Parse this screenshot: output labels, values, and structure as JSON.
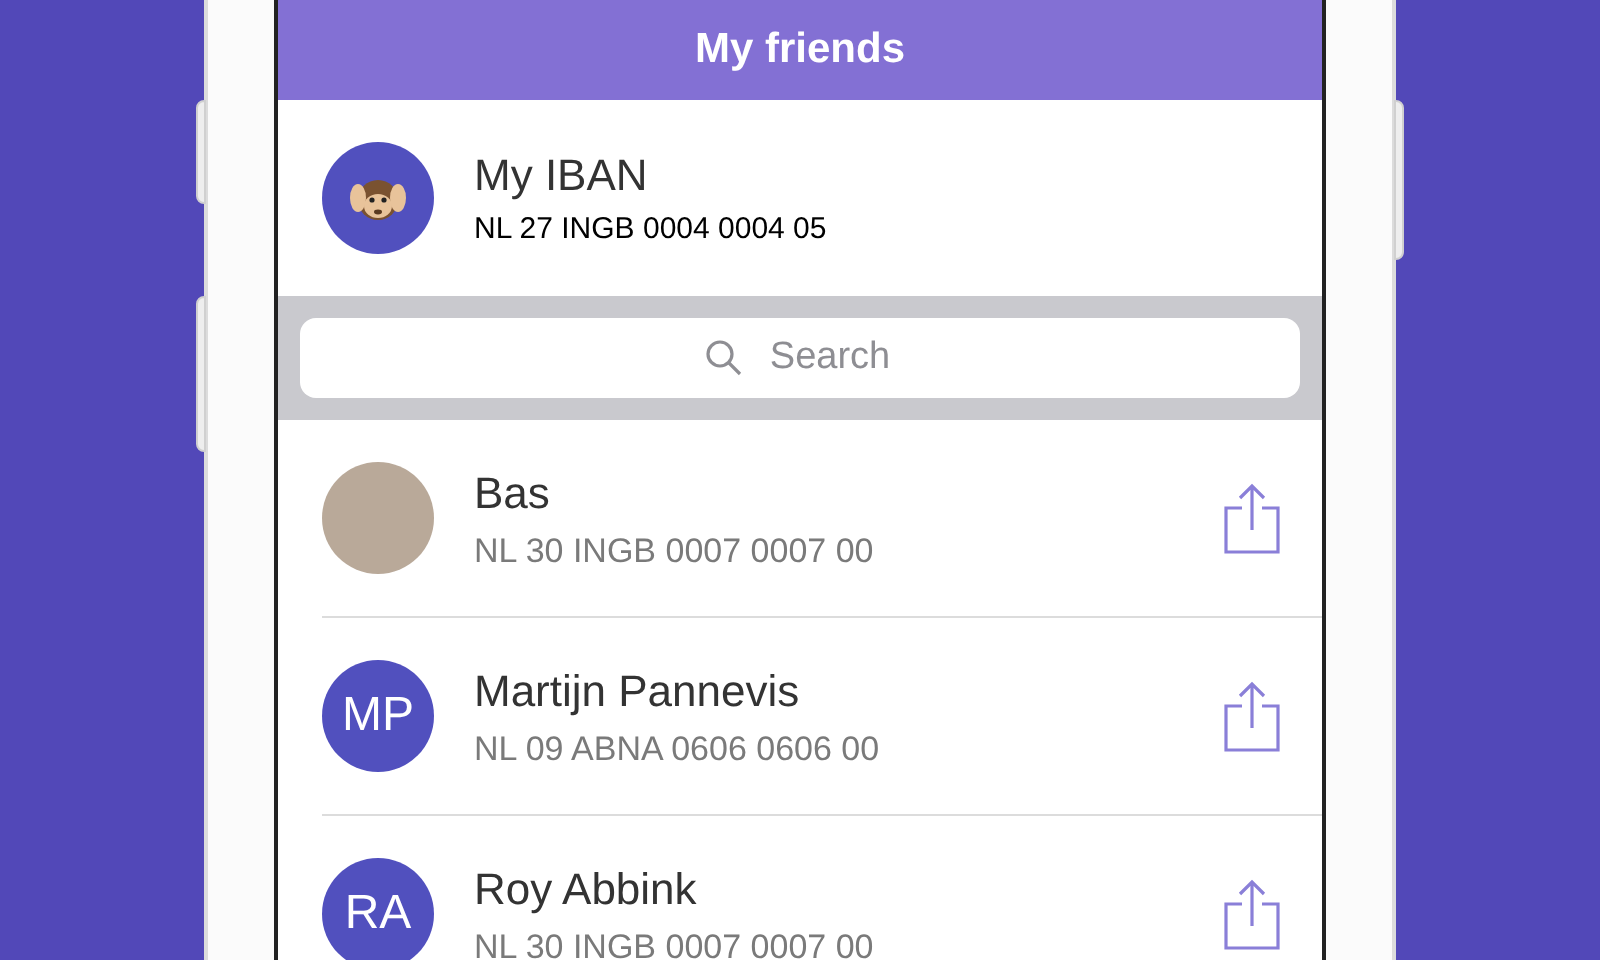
{
  "header": {
    "title": "My friends"
  },
  "my_iban": {
    "label": "My IBAN",
    "iban": "NL 27 INGB 0004 0004 05"
  },
  "search": {
    "placeholder": "Search"
  },
  "friends": [
    {
      "kind": "photo",
      "name": "Bas",
      "iban": "NL 30 INGB 0007 0007 00"
    },
    {
      "kind": "initials",
      "initials": "MP",
      "name": "Martijn Pannevis",
      "iban": "NL 09 ABNA 0606 0606 00"
    },
    {
      "kind": "initials",
      "initials": "RA",
      "name": "Roy Abbink",
      "iban": "NL 30 INGB 0007 0007 00"
    }
  ]
}
